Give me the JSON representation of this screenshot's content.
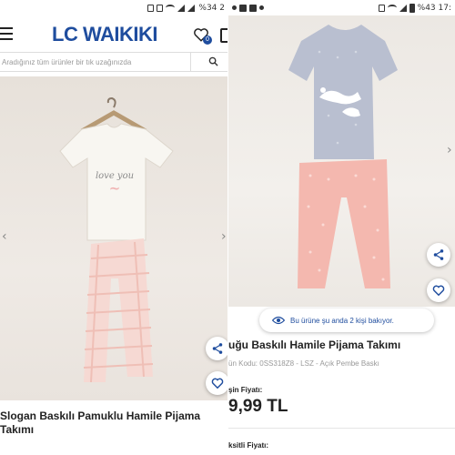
{
  "left": {
    "status": {
      "text": "%34 2"
    },
    "header": {
      "logo": "LC WAIKIKI",
      "wishlist_count": "0"
    },
    "search": {
      "placeholder": "Aradığınız tüm ürünler bir tık uzağınızda"
    },
    "product": {
      "tshirt_print": "love you",
      "title": "Slogan Baskılı Pamuklu Hamile Pijama Takımı"
    }
  },
  "right": {
    "status": {
      "text": "%43 17:"
    },
    "viewers": "Bu ürüne şu anda 2 kişi bakıyor.",
    "product": {
      "title": "uğu Baskılı Hamile Pijama Takımı",
      "code": "ün Kodu: 0SS318Z8 - LSZ - Açık Pembe Baskı",
      "price_label": "şin Fiyatı:",
      "price": "9,99 TL",
      "price2_label": "ksitli Fiyatı:"
    }
  },
  "colors": {
    "brand": "#1f4d9e",
    "pink": "#f5b5ad",
    "grey_top": "#b9bfd0"
  }
}
